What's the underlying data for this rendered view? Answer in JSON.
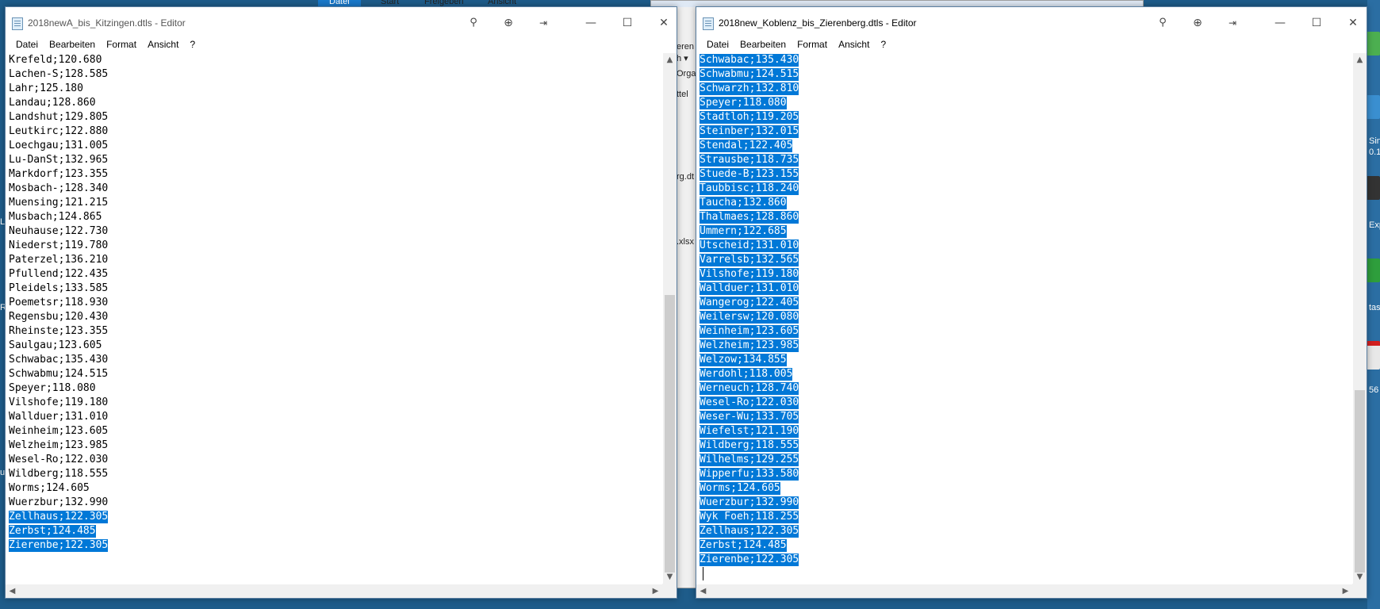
{
  "background": {
    "explorer_tabs": [
      "Datei",
      "Start",
      "Freigeben",
      "Ansicht"
    ],
    "fragments": [
      "eren",
      "h ▾",
      "Orga",
      "ttel",
      "rg.dt",
      ".xlsx"
    ],
    "desktop_fragments": [
      "Sin",
      "0.1",
      "Exp",
      "tas",
      "56",
      "L",
      "R",
      "u"
    ]
  },
  "left_window": {
    "title": "2018newA_bis_Kitzingen.dtls - Editor",
    "menu": [
      "Datei",
      "Bearbeiten",
      "Format",
      "Ansicht",
      "?"
    ],
    "lines": [
      "Krefeld;120.680",
      "Lachen-S;128.585",
      "Lahr;125.180",
      "Landau;128.860",
      "Landshut;129.805",
      "Leutkirc;122.880",
      "Loechgau;131.005",
      "Lu-DanSt;132.965",
      "Markdorf;123.355",
      "Mosbach-;128.340",
      "Muensing;121.215",
      "Musbach;124.865",
      "Neuhause;122.730",
      "Niederst;119.780",
      "Paterzel;136.210",
      "Pfullend;122.435",
      "Pleidels;133.585",
      "Poemetsr;118.930",
      "Regensbu;120.430",
      "Rheinste;123.355",
      "Saulgau;123.605",
      "Schwabac;135.430",
      "Schwabmu;124.515",
      "Speyer;118.080",
      "Vilshofe;119.180",
      "Wallduer;131.010",
      "Weinheim;123.605",
      "Welzheim;123.985",
      "Wesel-Ro;122.030",
      "Wildberg;118.555",
      "Worms;124.605",
      "Wuerzbur;132.990",
      "Zellhaus;122.305",
      "Zerbst;124.485",
      "Zierenbe;122.305"
    ],
    "selected_from": 32
  },
  "right_window": {
    "title": "2018new_Koblenz_bis_Zierenberg.dtls - Editor",
    "menu": [
      "Datei",
      "Bearbeiten",
      "Format",
      "Ansicht",
      "?"
    ],
    "lines": [
      "Schwabac;135.430",
      "Schwabmu;124.515",
      "Schwarzh;132.810",
      "Speyer;118.080",
      "Stadtloh;119.205",
      "Steinber;132.015",
      "Stendal;122.405",
      "Strausbe;118.735",
      "Stuede-B;123.155",
      "Taubbisc;118.240",
      "Taucha;132.860",
      "Thalmaes;128.860",
      "Ummern;122.685",
      "Utscheid;131.010",
      "Varrelsb;132.565",
      "Vilshofe;119.180",
      "Wallduer;131.010",
      "Wangerog;122.405",
      "Weilersw;120.080",
      "Weinheim;123.605",
      "Welzheim;123.985",
      "Welzow;134.855",
      "Werdohl;118.005",
      "Werneuch;128.740",
      "Wesel-Ro;122.030",
      "Weser-Wu;133.705",
      "Wiefelst;121.190",
      "Wildberg;118.555",
      "Wilhelms;129.255",
      "Wipperfu;133.580",
      "Worms;124.605",
      "Wuerzbur;132.990",
      "Wyk Foeh;118.255",
      "Zellhaus;122.305",
      "Zerbst;124.485",
      "Zierenbe;122.305"
    ],
    "selected_from": 0
  },
  "titlebar_buttons": {
    "minimize": "—",
    "maximize": "☐",
    "close": "✕"
  },
  "colors": {
    "selection": "#0078d7",
    "desktop": "#1e5c8a"
  }
}
